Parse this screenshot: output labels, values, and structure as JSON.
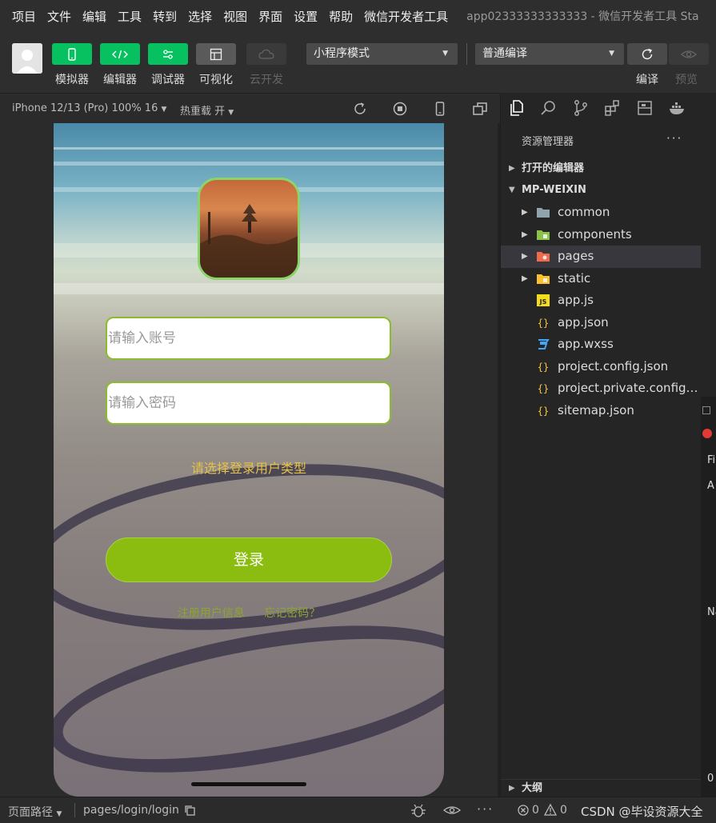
{
  "menubar": {
    "items": [
      "项目",
      "文件",
      "编辑",
      "工具",
      "转到",
      "选择",
      "视图",
      "界面",
      "设置",
      "帮助",
      "微信开发者工具"
    ],
    "window_title": "app02333333333333 - 微信开发者工具 Sta"
  },
  "toolbar": {
    "buttons": [
      "模拟器",
      "编辑器",
      "调试器",
      "可视化",
      "云开发"
    ],
    "mode_select": "小程序模式",
    "compile_select": "普通编译",
    "compile_label": "编译",
    "preview_label": "预览"
  },
  "simulator": {
    "device": "iPhone 12/13 (Pro) 100% 16",
    "hot_reload": "热重载 开",
    "page": {
      "account_placeholder": "请输入账号",
      "password_placeholder": "请输入密码",
      "user_type": "请选择登录用户类型",
      "login_label": "登录",
      "register_link": "注册用户信息",
      "forgot_link": "忘记密码？"
    }
  },
  "explorer": {
    "title": "资源管理器",
    "more": "···",
    "open_editors": "打开的编辑器",
    "project": "MP-WEIXIN",
    "outline": "大纲",
    "items": [
      {
        "name": "common",
        "icon": "folder-icon",
        "color": "#90a4ae"
      },
      {
        "name": "components",
        "icon": "folder-icon",
        "color": "#8bc34a"
      },
      {
        "name": "pages",
        "icon": "folder-icon",
        "color": "#ef6c4a"
      },
      {
        "name": "static",
        "icon": "folder-icon",
        "color": "#fbc02d"
      },
      {
        "name": "app.js",
        "icon": "js-icon",
        "color": "#f5de19"
      },
      {
        "name": "app.json",
        "icon": "json-icon",
        "color": "#f5c542"
      },
      {
        "name": "app.wxss",
        "icon": "css-icon",
        "color": "#42a5f5"
      },
      {
        "name": "project.config.json",
        "icon": "json-icon",
        "color": "#f5c542"
      },
      {
        "name": "project.private.config.js...",
        "icon": "json-icon",
        "color": "#f5c542"
      },
      {
        "name": "sitemap.json",
        "icon": "json-icon",
        "color": "#f5c542"
      }
    ],
    "side_fragments": [
      "Fi",
      "A",
      "Na",
      "0"
    ]
  },
  "statusbar": {
    "page_path_label": "页面路径",
    "page_path": "pages/login/login",
    "errors": "0",
    "warnings": "0",
    "watermark": "CSDN @毕设资源大全"
  }
}
